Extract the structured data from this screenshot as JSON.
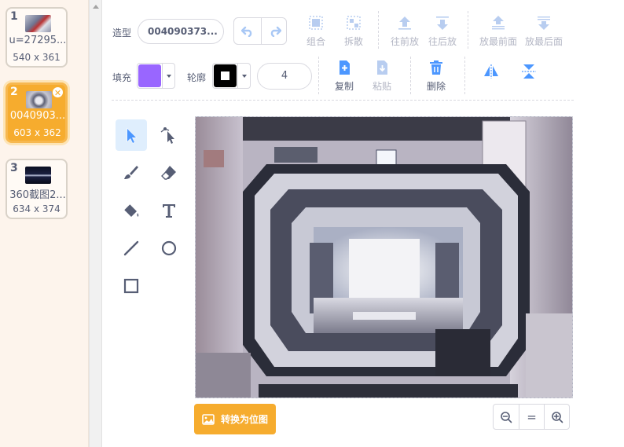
{
  "costumes": [
    {
      "num": "1",
      "name": "u=27295...",
      "size": "540 x 361"
    },
    {
      "num": "2",
      "name": "0040903...",
      "size": "603 x 362"
    },
    {
      "num": "3",
      "name": "360截图2...",
      "size": "634 x 374"
    }
  ],
  "toolbar": {
    "costume_label": "造型",
    "costume_name": "004090373...",
    "fill_label": "填充",
    "outline_label": "轮廓",
    "outline_width": "4",
    "group": "组合",
    "ungroup": "拆散",
    "forward": "往前放",
    "backward": "往后放",
    "front": "放最前面",
    "back": "放最后面",
    "copy": "复制",
    "paste": "粘贴",
    "delete": "删除"
  },
  "colors": {
    "fill": "#9966ff",
    "outline": "#000000",
    "accent_blue": "#4c97ff",
    "selected_orange": "#f6ac2e"
  },
  "bottom": {
    "convert_bitmap": "转换为位图",
    "zoom_reset": "="
  }
}
